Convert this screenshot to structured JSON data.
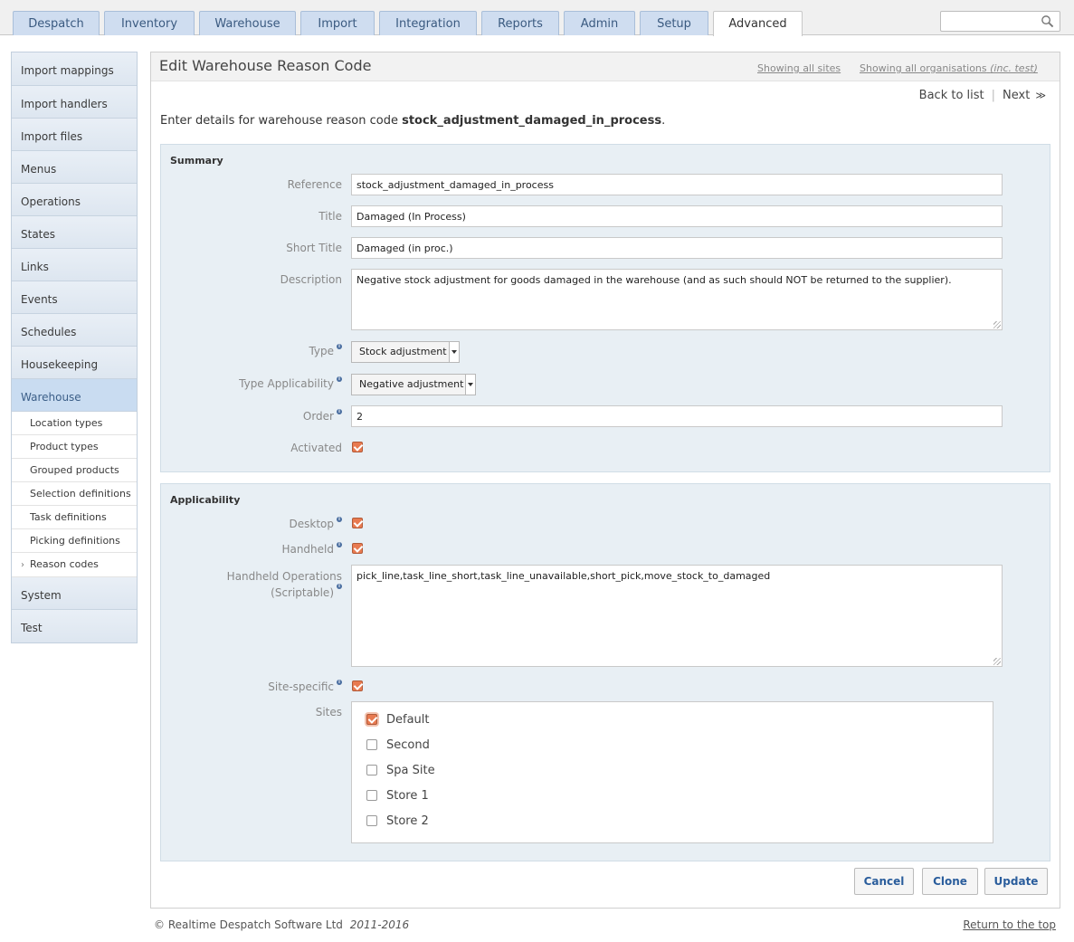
{
  "tabs": [
    {
      "label": "Despatch",
      "active": false
    },
    {
      "label": "Inventory",
      "active": false
    },
    {
      "label": "Warehouse",
      "active": false
    },
    {
      "label": "Import",
      "active": false
    },
    {
      "label": "Integration",
      "active": false
    },
    {
      "label": "Reports",
      "active": false
    },
    {
      "label": "Admin",
      "active": false
    },
    {
      "label": "Setup",
      "active": false
    },
    {
      "label": "Advanced",
      "active": true
    }
  ],
  "search": {
    "value": "",
    "icon": "search-icon"
  },
  "sidebar": {
    "items": [
      {
        "label": "Import mappings"
      },
      {
        "label": "Import handlers"
      },
      {
        "label": "Import files"
      },
      {
        "label": "Menus"
      },
      {
        "label": "Operations"
      },
      {
        "label": "States"
      },
      {
        "label": "Links"
      },
      {
        "label": "Events"
      },
      {
        "label": "Schedules"
      },
      {
        "label": "Housekeeping"
      },
      {
        "label": "Warehouse",
        "active": true
      }
    ],
    "subitems": [
      {
        "label": "Location types"
      },
      {
        "label": "Product types"
      },
      {
        "label": "Grouped products"
      },
      {
        "label": "Selection definitions"
      },
      {
        "label": "Task definitions"
      },
      {
        "label": "Picking definitions"
      },
      {
        "label": "Reason codes",
        "current": true
      }
    ],
    "bottom_items": [
      {
        "label": "System"
      },
      {
        "label": "Test"
      }
    ]
  },
  "header": {
    "title": "Edit Warehouse Reason Code",
    "sites_link": "Showing all sites",
    "orgs_link": "Showing all organisations",
    "orgs_link_suffix": "(inc. test)"
  },
  "nav": {
    "back": "Back to list",
    "next": "Next",
    "next_icon": "≫"
  },
  "intro": {
    "prefix": "Enter details for warehouse reason code",
    "code": "stock_adjustment_damaged_in_process",
    "suffix": "."
  },
  "summary": {
    "title": "Summary",
    "reference_label": "Reference",
    "reference_value": "stock_adjustment_damaged_in_process",
    "title_label": "Title",
    "title_value": "Damaged (In Process)",
    "short_title_label": "Short Title",
    "short_title_value": "Damaged (in proc.)",
    "description_label": "Description",
    "description_value": "Negative stock adjustment for goods damaged in the warehouse (and as such should NOT be returned to the supplier).",
    "type_label": "Type",
    "type_value": "Stock adjustment",
    "applicability_label": "Type Applicability",
    "applicability_value": "Negative adjustment",
    "order_label": "Order",
    "order_value": "2",
    "activated_label": "Activated",
    "activated": true
  },
  "applicability": {
    "title": "Applicability",
    "desktop_label": "Desktop",
    "desktop": true,
    "handheld_label": "Handheld",
    "handheld": true,
    "ops_label_line1": "Handheld Operations",
    "ops_label_line2": "(Scriptable)",
    "ops_value": "pick_line,task_line_short,task_line_unavailable,short_pick,move_stock_to_damaged",
    "site_specific_label": "Site-specific",
    "site_specific": true,
    "sites_label": "Sites",
    "sites": [
      {
        "name": "Default",
        "checked": true
      },
      {
        "name": "Second",
        "checked": false
      },
      {
        "name": "Spa Site",
        "checked": false
      },
      {
        "name": "Store 1",
        "checked": false
      },
      {
        "name": "Store 2",
        "checked": false
      }
    ]
  },
  "buttons": {
    "cancel": "Cancel",
    "clone": "Clone",
    "update": "Update"
  },
  "footer": {
    "copyright": "© Realtime Despatch Software Ltd",
    "years": "2011-2016",
    "top_link": "Return to the top"
  },
  "colors": {
    "accent": "#e87a50",
    "tab": "#cfddf0",
    "panel": "#e8eff4",
    "link": "#2a5d9c"
  }
}
